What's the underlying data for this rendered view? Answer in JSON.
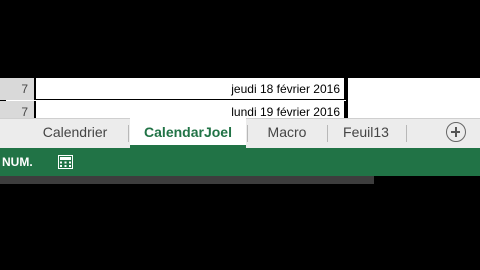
{
  "grid": {
    "rows": [
      {
        "num": "7",
        "value": "jeudi 18 février 2016"
      },
      {
        "num": "7",
        "value": "lundi 19 février 2016"
      }
    ]
  },
  "tabs": [
    {
      "label": "Calendrier",
      "active": false
    },
    {
      "label": "CalendarJoel",
      "active": true
    },
    {
      "label": "Macro",
      "active": false
    },
    {
      "label": "Feuil13",
      "active": false
    }
  ],
  "status": {
    "mode": "NUM."
  },
  "colors": {
    "accent": "#217346",
    "tabbar": "#ececec"
  }
}
